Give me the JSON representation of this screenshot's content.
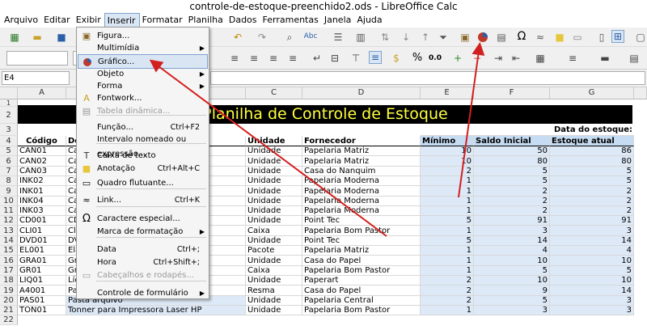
{
  "window": {
    "title": "controle-de-estoque-preenchido2.ods - LibreOffice Calc"
  },
  "menubar": {
    "items": [
      "Arquivo",
      "Editar",
      "Exibir",
      "Inserir",
      "Formatar",
      "Planilha",
      "Dados",
      "Ferramentas",
      "Janela",
      "Ajuda"
    ],
    "active": "Inserir"
  },
  "namebox": {
    "value": "E4"
  },
  "columns": [
    "A",
    "B",
    "C",
    "D",
    "E",
    "F",
    "G"
  ],
  "banner": {
    "text": "Planilha de Controle de Estoque"
  },
  "date_label": "Data do estoque:",
  "headers": {
    "codigo": "Código",
    "descricao": "De",
    "unidade": "Unidade",
    "fornecedor": "Fornecedor",
    "minimo": "Mínimo",
    "saldo": "Saldo Inicial",
    "atual": "Estoque atual"
  },
  "rows": [
    {
      "r": "5",
      "code": "CAN01",
      "desc": "Ca",
      "un": "Unidade",
      "forn": "Papelaria Matriz",
      "min": "10",
      "saldo": "50",
      "atual": "86"
    },
    {
      "r": "6",
      "code": "CAN02",
      "desc": "Ca",
      "un": "Unidade",
      "forn": "Papelaria Matriz",
      "min": "10",
      "saldo": "80",
      "atual": "80"
    },
    {
      "r": "7",
      "code": "CAN03",
      "desc": "Ca",
      "un": "Unidade",
      "forn": "Casa do Nanquim",
      "min": "2",
      "saldo": "5",
      "atual": "5"
    },
    {
      "r": "8",
      "code": "INK02",
      "desc": "Ca",
      "un": "Unidade",
      "forn": "Papelaria Moderna",
      "min": "1",
      "saldo": "5",
      "atual": "5"
    },
    {
      "r": "9",
      "code": "INK01",
      "desc": "Ca",
      "un": "Unidade",
      "forn": "Papelaria Moderna",
      "min": "1",
      "saldo": "2",
      "atual": "2"
    },
    {
      "r": "10",
      "code": "INK04",
      "desc": "Ca",
      "un": "Unidade",
      "forn": "Papelaria Moderna",
      "min": "1",
      "saldo": "2",
      "atual": "2"
    },
    {
      "r": "11",
      "code": "INK03",
      "desc": "Ca",
      "un": "Unidade",
      "forn": "Papelaria Moderna",
      "min": "1",
      "saldo": "2",
      "atual": "2"
    },
    {
      "r": "12",
      "code": "CD001",
      "desc": "CD",
      "un": "Unidade",
      "forn": "Point Tec",
      "min": "5",
      "saldo": "91",
      "atual": "91"
    },
    {
      "r": "13",
      "code": "CLI01",
      "desc": "Cli",
      "un": "Caixa",
      "forn": "Papelaria Bom Pastor",
      "min": "1",
      "saldo": "3",
      "atual": "3"
    },
    {
      "r": "14",
      "code": "DVD01",
      "desc": "DV",
      "un": "Unidade",
      "forn": "Point Tec",
      "min": "5",
      "saldo": "14",
      "atual": "14"
    },
    {
      "r": "15",
      "code": "EL001",
      "desc": "Elá",
      "un": "Pacote",
      "forn": "Papelaria Matriz",
      "min": "1",
      "saldo": "4",
      "atual": "4"
    },
    {
      "r": "16",
      "code": "GRA01",
      "desc": "Gr",
      "un": "Unidade",
      "forn": "Casa do Papel",
      "min": "1",
      "saldo": "10",
      "atual": "10"
    },
    {
      "r": "17",
      "code": "GR01",
      "desc": "Gr",
      "un": "Caixa",
      "forn": "Papelaria Bom Pastor",
      "min": "1",
      "saldo": "5",
      "atual": "5"
    },
    {
      "r": "18",
      "code": "LIQ01",
      "desc": "Líq",
      "un": "Unidade",
      "forn": "Paperart",
      "min": "2",
      "saldo": "10",
      "atual": "10"
    },
    {
      "r": "19",
      "code": "A4001",
      "desc": "Pa",
      "un": "Resma",
      "forn": "Casa do Papel",
      "min": "2",
      "saldo": "9",
      "atual": "14"
    },
    {
      "r": "20",
      "code": "PAS01",
      "desc": "Pasta arquivo",
      "un": "Unidade",
      "forn": "Papelaria Central",
      "min": "2",
      "saldo": "5",
      "atual": "3"
    },
    {
      "r": "21",
      "code": "TON01",
      "desc": "Tonner para Impressora Laser HP",
      "un": "Unidade",
      "forn": "Papelaria Bom Pastor",
      "min": "1",
      "saldo": "3",
      "atual": "3"
    }
  ],
  "menu": {
    "items": [
      {
        "label": "Figura...",
        "icon": "image-icon",
        "shortcut": "",
        "arrow": false,
        "disabled": false
      },
      {
        "label": "Multimídia",
        "icon": "",
        "shortcut": "",
        "arrow": true,
        "disabled": false
      },
      {
        "label": "Gráfico...",
        "icon": "pie-chart-icon",
        "shortcut": "",
        "arrow": false,
        "disabled": false,
        "highlight": true
      },
      {
        "label": "Objeto",
        "icon": "",
        "shortcut": "",
        "arrow": true,
        "disabled": false
      },
      {
        "label": "Forma",
        "icon": "",
        "shortcut": "",
        "arrow": true,
        "disabled": false
      },
      {
        "label": "Fontwork...",
        "icon": "fontwork-icon",
        "shortcut": "",
        "arrow": false,
        "disabled": false
      },
      {
        "label": "Tabela dinâmica...",
        "icon": "pivot-table-icon",
        "shortcut": "",
        "arrow": false,
        "disabled": true
      },
      {
        "label": "Função...",
        "icon": "",
        "shortcut": "Ctrl+F2",
        "arrow": false,
        "disabled": false
      },
      {
        "label": "Intervalo nomeado ou expressão...",
        "icon": "",
        "shortcut": "",
        "arrow": false,
        "disabled": false
      },
      {
        "label": "Caixa de texto",
        "icon": "text-box-icon",
        "shortcut": "",
        "arrow": false,
        "disabled": false
      },
      {
        "label": "Anotação",
        "icon": "comment-icon",
        "shortcut": "Ctrl+Alt+C",
        "arrow": false,
        "disabled": false
      },
      {
        "label": "Quadro flutuante...",
        "icon": "frame-icon",
        "shortcut": "",
        "arrow": false,
        "disabled": false
      },
      {
        "label": "Link...",
        "icon": "hyperlink-icon",
        "shortcut": "Ctrl+K",
        "arrow": false,
        "disabled": false
      },
      {
        "label": "Caractere especial...",
        "icon": "omega-icon",
        "shortcut": "",
        "arrow": false,
        "disabled": false
      },
      {
        "label": "Marca de formatação",
        "icon": "",
        "shortcut": "",
        "arrow": true,
        "disabled": false
      },
      {
        "label": "Data",
        "icon": "",
        "shortcut": "Ctrl+;",
        "arrow": false,
        "disabled": false
      },
      {
        "label": "Hora",
        "icon": "",
        "shortcut": "Ctrl+Shift+;",
        "arrow": false,
        "disabled": false
      },
      {
        "label": "Cabeçalhos e rodapés...",
        "icon": "header-footer-icon",
        "shortcut": "",
        "arrow": false,
        "disabled": true
      },
      {
        "label": "Controle de formulário",
        "icon": "",
        "shortcut": "",
        "arrow": true,
        "disabled": false
      }
    ]
  },
  "annotation": {
    "color": "#d21f1f"
  }
}
